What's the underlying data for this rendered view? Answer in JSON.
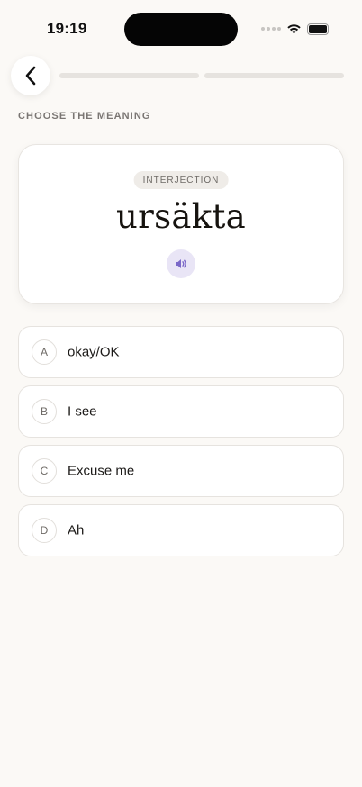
{
  "status_bar": {
    "time": "19:19"
  },
  "header": {
    "back_icon": "chevron-left-icon",
    "progress": [
      0.0,
      0.0
    ]
  },
  "instruction": "CHOOSE THE MEANING",
  "card": {
    "part_of_speech": "INTERJECTION",
    "word": "ursäkta",
    "audio_icon": "speaker-icon"
  },
  "options": [
    {
      "letter": "A",
      "text": "okay/OK"
    },
    {
      "letter": "B",
      "text": "I see"
    },
    {
      "letter": "C",
      "text": "Excuse me"
    },
    {
      "letter": "D",
      "text": "Ah"
    }
  ],
  "colors": {
    "background": "#fbf9f6",
    "accent": "#7b68c8",
    "audio_bg": "#e9e5f6"
  }
}
